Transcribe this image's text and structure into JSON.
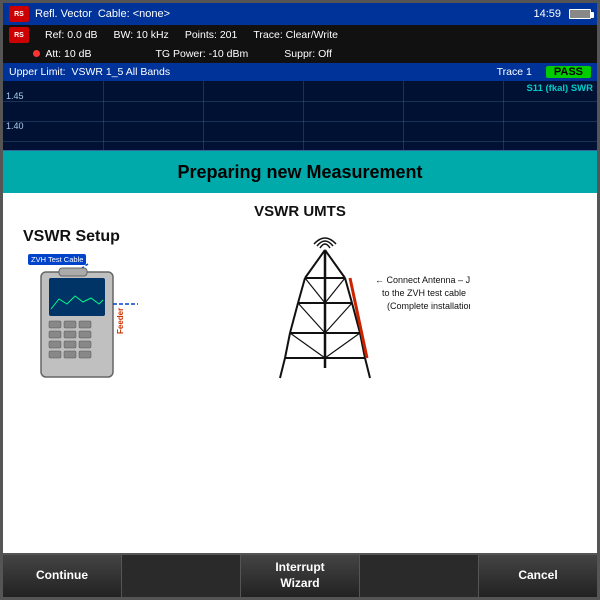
{
  "header": {
    "mode_label": "Refl. Vector",
    "cable_label": "Cable: <none>",
    "time": "14:59",
    "ref_label": "Ref:",
    "ref_value": "0.0 dB",
    "bw_label": "BW:",
    "bw_value": "10 kHz",
    "points_label": "Points:",
    "points_value": "201",
    "trace_label": "Trace:",
    "trace_value": "Clear/Write",
    "att_label": "Att:",
    "att_value": "10 dB",
    "tg_power_label": "TG Power:",
    "tg_power_value": "-10 dBm",
    "suppr_label": "Suppr:",
    "suppr_value": "Off"
  },
  "limit_bar": {
    "upper_limit_label": "Upper Limit:",
    "upper_limit_value": "VSWR 1_5 All Bands",
    "trace_label": "Trace 1",
    "pass_label": "PASS",
    "s11_label": "S11 (fkal) SWR"
  },
  "spectrum": {
    "y_labels": [
      "1.45",
      "1.40"
    ],
    "s11_tag": "S11 (fkal) SWR"
  },
  "banner": {
    "text": "Preparing new Measurement"
  },
  "main": {
    "vswr_umts_title": "VSWR UMTS",
    "vswr_setup_title": "VSWR Setup",
    "cable_box_label": "ZVH Test Cable",
    "feeder_label": "Feeder",
    "connect_text": "← Connect Antenna – Jumper – Feeder\nto the ZVH test cable\n(Complete installation)"
  },
  "toolbar": {
    "continue_label": "Continue",
    "interrupt_label": "Interrupt\nWizard",
    "cancel_label": "Cancel"
  }
}
